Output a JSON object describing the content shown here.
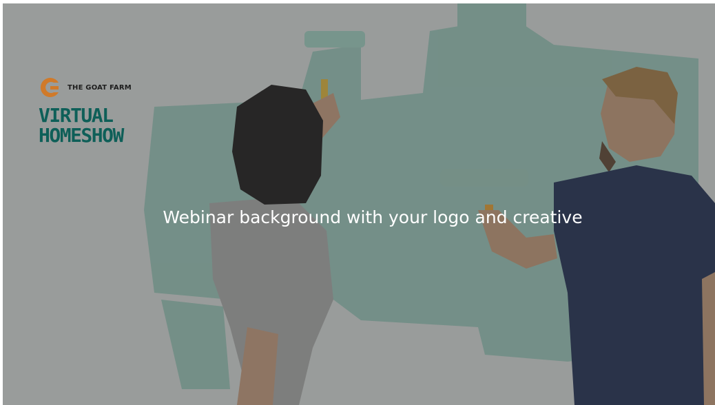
{
  "slide": {
    "brand": {
      "name": "THE GOAT FARM",
      "mark_icon": "g-logo-icon",
      "mark_color": "#d07a2a",
      "headline_line1": "VIRTUAL",
      "headline_line2": "HOMESHOW",
      "headline_color": "#0e5f58"
    },
    "caption": "Webinar background with your logo and creative",
    "colors": {
      "wall": "#d8dcda",
      "paint": "#8fc3b5",
      "overlay": "#3c3c3c"
    }
  }
}
